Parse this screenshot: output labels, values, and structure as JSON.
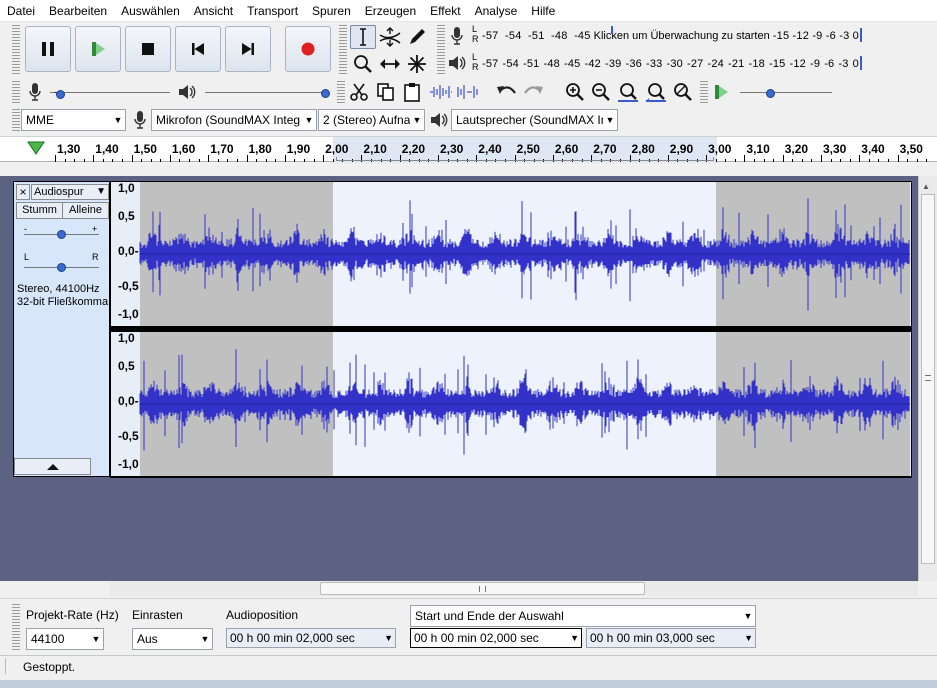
{
  "menu": [
    "Datei",
    "Bearbeiten",
    "Auswählen",
    "Ansicht",
    "Transport",
    "Spuren",
    "Erzeugen",
    "Effekt",
    "Analyse",
    "Hilfe"
  ],
  "transport": {
    "buttons": [
      "pause-icon",
      "play-icon",
      "stop-icon",
      "skip-to-start-icon",
      "skip-to-end-icon",
      "record-icon"
    ],
    "colors": {
      "play": "#2e8b3a",
      "record": "#e02020"
    }
  },
  "tools": [
    "selection-tool-icon",
    "envelope-tool-icon",
    "draw-tool-icon",
    "zoom-tool-icon",
    "timeshift-tool-icon",
    "multi-tool-icon"
  ],
  "meters": {
    "record_scale": [
      "-57",
      "-54",
      "-51",
      "-48",
      "-45"
    ],
    "record_hint": "Klicken um Überwachung zu starten",
    "record_scale_right": [
      "-15",
      "-12",
      "-9",
      "-6",
      "-3",
      "0"
    ],
    "play_scale": [
      "-57",
      "-54",
      "-51",
      "-48",
      "-45",
      "-42",
      "-39",
      "-36",
      "-33",
      "-30",
      "-27",
      "-24",
      "-21",
      "-18",
      "-15",
      "-12",
      "-9",
      "-6",
      "-3",
      "0"
    ],
    "channel_left": "L",
    "channel_right": "R"
  },
  "devices": {
    "host": "MME",
    "input": "Mikrofon (SoundMAX Integ",
    "channels": "2 (Stereo) Aufna",
    "output": "Lautsprecher (SoundMAX In"
  },
  "ruler": {
    "labels": [
      "1,30",
      "1,40",
      "1,50",
      "1,60",
      "1,70",
      "1,80",
      "1,90",
      "2,00",
      "2,10",
      "2,20",
      "2,30",
      "2,40",
      "2,50",
      "2,60",
      "2,70",
      "2,80",
      "2,90",
      "3,00",
      "3,10",
      "3,20",
      "3,30",
      "3,40",
      "3,50"
    ],
    "selection_start": 2.0,
    "selection_end": 3.0
  },
  "track": {
    "close_label": "×",
    "name": "Audiospur",
    "mute_label": "Stumm",
    "solo_label": "Alleine",
    "pan_left": "L",
    "pan_right": "R",
    "info_rate": "Stereo, 44100Hz",
    "info_format": "32-bit Fließkomma",
    "amp_labels": [
      "1,0",
      "0,5",
      "0,0-",
      "-0,5",
      "-1,0"
    ],
    "colors": {
      "wave": "#3232c8",
      "unselected_bg": "#c0c0c0",
      "selected_bg": "#ffffff",
      "panel": "#d7e6fa"
    }
  },
  "selection_bar": {
    "rate_label": "Projekt-Rate (Hz)",
    "rate_value": "44100",
    "snap_label": "Einrasten",
    "snap_value": "Aus",
    "audiopos_label": "Audioposition",
    "audiopos_value": "00 h 00 min 02,000 sec",
    "mode_value": "Start und Ende der Auswahl",
    "start_value": "00 h 00 min 02,000 sec",
    "end_value": "00 h 00 min 03,000 sec"
  },
  "status": "Gestoppt."
}
